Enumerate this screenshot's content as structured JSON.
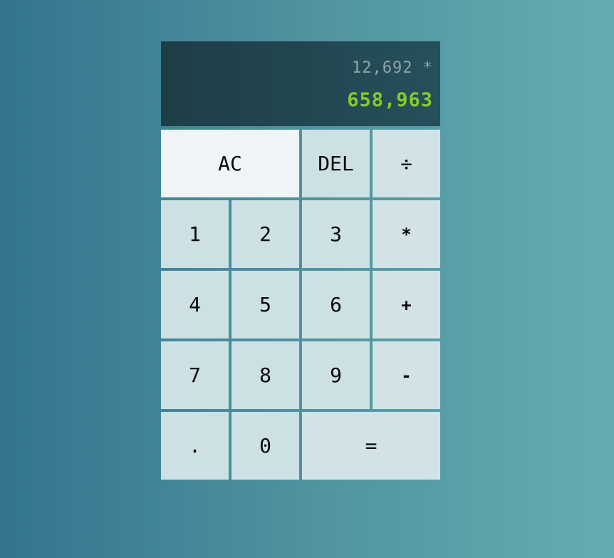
{
  "display": {
    "previous": "12,692 *",
    "current": "658,963"
  },
  "buttons": {
    "ac": "AC",
    "del": "DEL",
    "divide": "÷",
    "one": "1",
    "two": "2",
    "three": "3",
    "multiply": "*",
    "four": "4",
    "five": "5",
    "six": "6",
    "add": "+",
    "seven": "7",
    "eight": "8",
    "nine": "9",
    "subtract": "-",
    "decimal": ".",
    "zero": "0",
    "equals": "="
  },
  "colors": {
    "display_background": "#1f3d47",
    "previous_text": "#8fa4aa",
    "current_text": "#84cc2a",
    "button_background": "#cde0e4",
    "ac_background": "#eff5f6"
  }
}
